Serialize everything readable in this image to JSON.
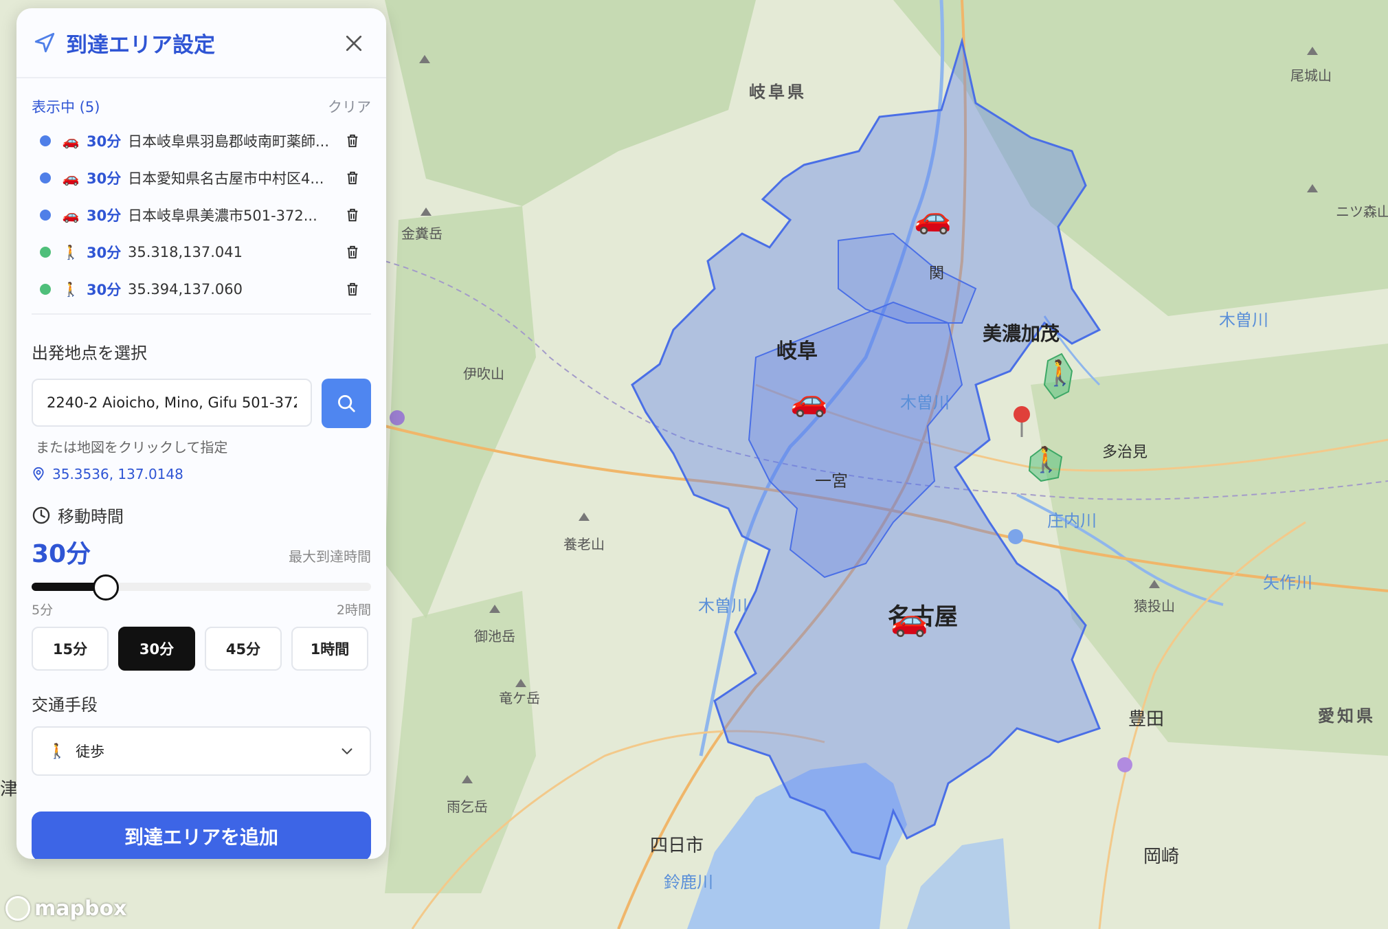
{
  "panel": {
    "title": "到達エリア設定",
    "list_label": "表示中 (5)",
    "clear_label": "クリア",
    "areas": [
      {
        "dot_color": "#4f7fe8",
        "mode": "🚗",
        "minutes": "30分",
        "address": "日本岐阜県羽島郡岐南町薬師..."
      },
      {
        "dot_color": "#4f7fe8",
        "mode": "🚗",
        "minutes": "30分",
        "address": "日本愛知県名古屋市中村区4..."
      },
      {
        "dot_color": "#4f7fe8",
        "mode": "🚗",
        "minutes": "30分",
        "address": "日本岐阜県美濃市501-372..."
      },
      {
        "dot_color": "#4fbf7a",
        "mode": "🚶",
        "minutes": "30分",
        "address": "35.318,137.041"
      },
      {
        "dot_color": "#4fbf7a",
        "mode": "🚶",
        "minutes": "30分",
        "address": "35.394,137.060"
      }
    ],
    "origin_title": "出発地点を選択",
    "origin_value": "2240-2 Aioicho, Mino, Gifu 501-372",
    "origin_hint": "または地図をクリックして指定",
    "origin_coords": "35.3536, 137.0148",
    "time_title": "移動時間",
    "time_value": "30分",
    "time_note": "最大到達時間",
    "slider_fraction": 0.217,
    "slider_min": "5分",
    "slider_max": "2時間",
    "presets": [
      "15分",
      "30分",
      "45分",
      "1時間"
    ],
    "active_preset": "30分",
    "transport_title": "交通手段",
    "transport_icon": "🚶",
    "transport_value": "徒歩",
    "add_button": "到達エリアを追加"
  },
  "map": {
    "labels": {
      "gifu_pref": "岐阜県",
      "aichi_pref": "愛知県",
      "gifu": "岐阜",
      "nagoya": "名古屋",
      "ichinomiya": "一宮",
      "minokamo": "美濃加茂",
      "seki": "関",
      "tajimi": "多治見",
      "toyota": "豊田",
      "okazaki": "岡崎",
      "yokkaichi": "四日市",
      "kisogawa1": "木曽川",
      "kisogawa2": "木曽川",
      "kisogawa3": "木曽川",
      "shonaigawa": "庄内川",
      "yahagigawa": "矢作川",
      "suzukagawa": "鈴鹿川",
      "ibukiyama": "伊吹山",
      "kinkazan": "金糞岳",
      "yoroyama": "養老山",
      "mikedake": "御池岳",
      "ryugatake": "竜ケ岳",
      "amagotake": "雨乞岳",
      "sanageyama": "猿投山",
      "futatsumori": "ニツ森山",
      "ojoyama": "尾城山",
      "tsu": "津"
    },
    "attribution": "mapbox",
    "isochrone_color": "#5b7ff0",
    "walk_color": "#4fbf7a"
  }
}
